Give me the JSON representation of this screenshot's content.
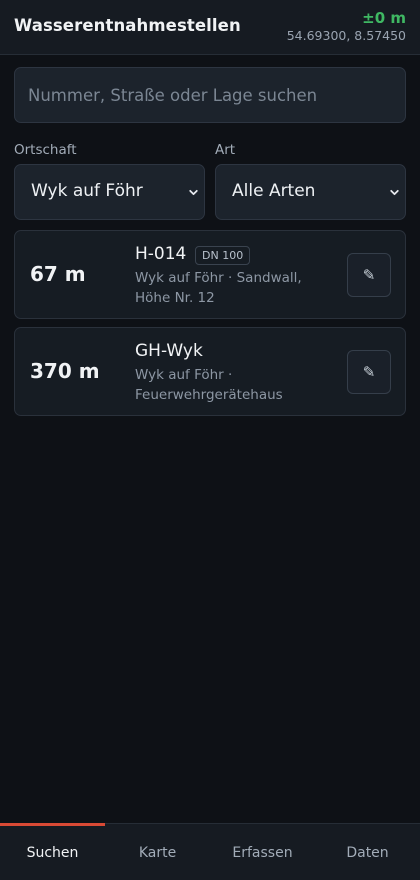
{
  "header": {
    "title": "Wasserentnahmestellen",
    "accuracy": "±0 m",
    "coordinates": "54.69300, 8.57450"
  },
  "search": {
    "placeholder": "Nummer, Straße oder Lage suchen",
    "value": ""
  },
  "filters": {
    "ortschaft": {
      "label": "Ortschaft",
      "value": "Wyk auf Föhr"
    },
    "art": {
      "label": "Art",
      "value": "Alle Arten"
    }
  },
  "results": [
    {
      "distance": "67 m",
      "name": "H-014",
      "badge": "DN 100",
      "description": "Wyk auf Föhr · Sandwall, Höhe Nr. 12"
    },
    {
      "distance": "370 m",
      "name": "GH-Wyk",
      "badge": "",
      "description": "Wyk auf Föhr · Feuerwehrgerätehaus"
    }
  ],
  "icons": {
    "edit": "pencil-icon",
    "dropdown": "chevron-down-icon"
  },
  "nav": {
    "items": [
      {
        "label": "Suchen",
        "active": true
      },
      {
        "label": "Karte",
        "active": false
      },
      {
        "label": "Erfassen",
        "active": false
      },
      {
        "label": "Daten",
        "active": false
      }
    ]
  },
  "colors": {
    "accent": "#d94a35",
    "gps_ok": "#3fb863",
    "background": "#0e1116"
  }
}
